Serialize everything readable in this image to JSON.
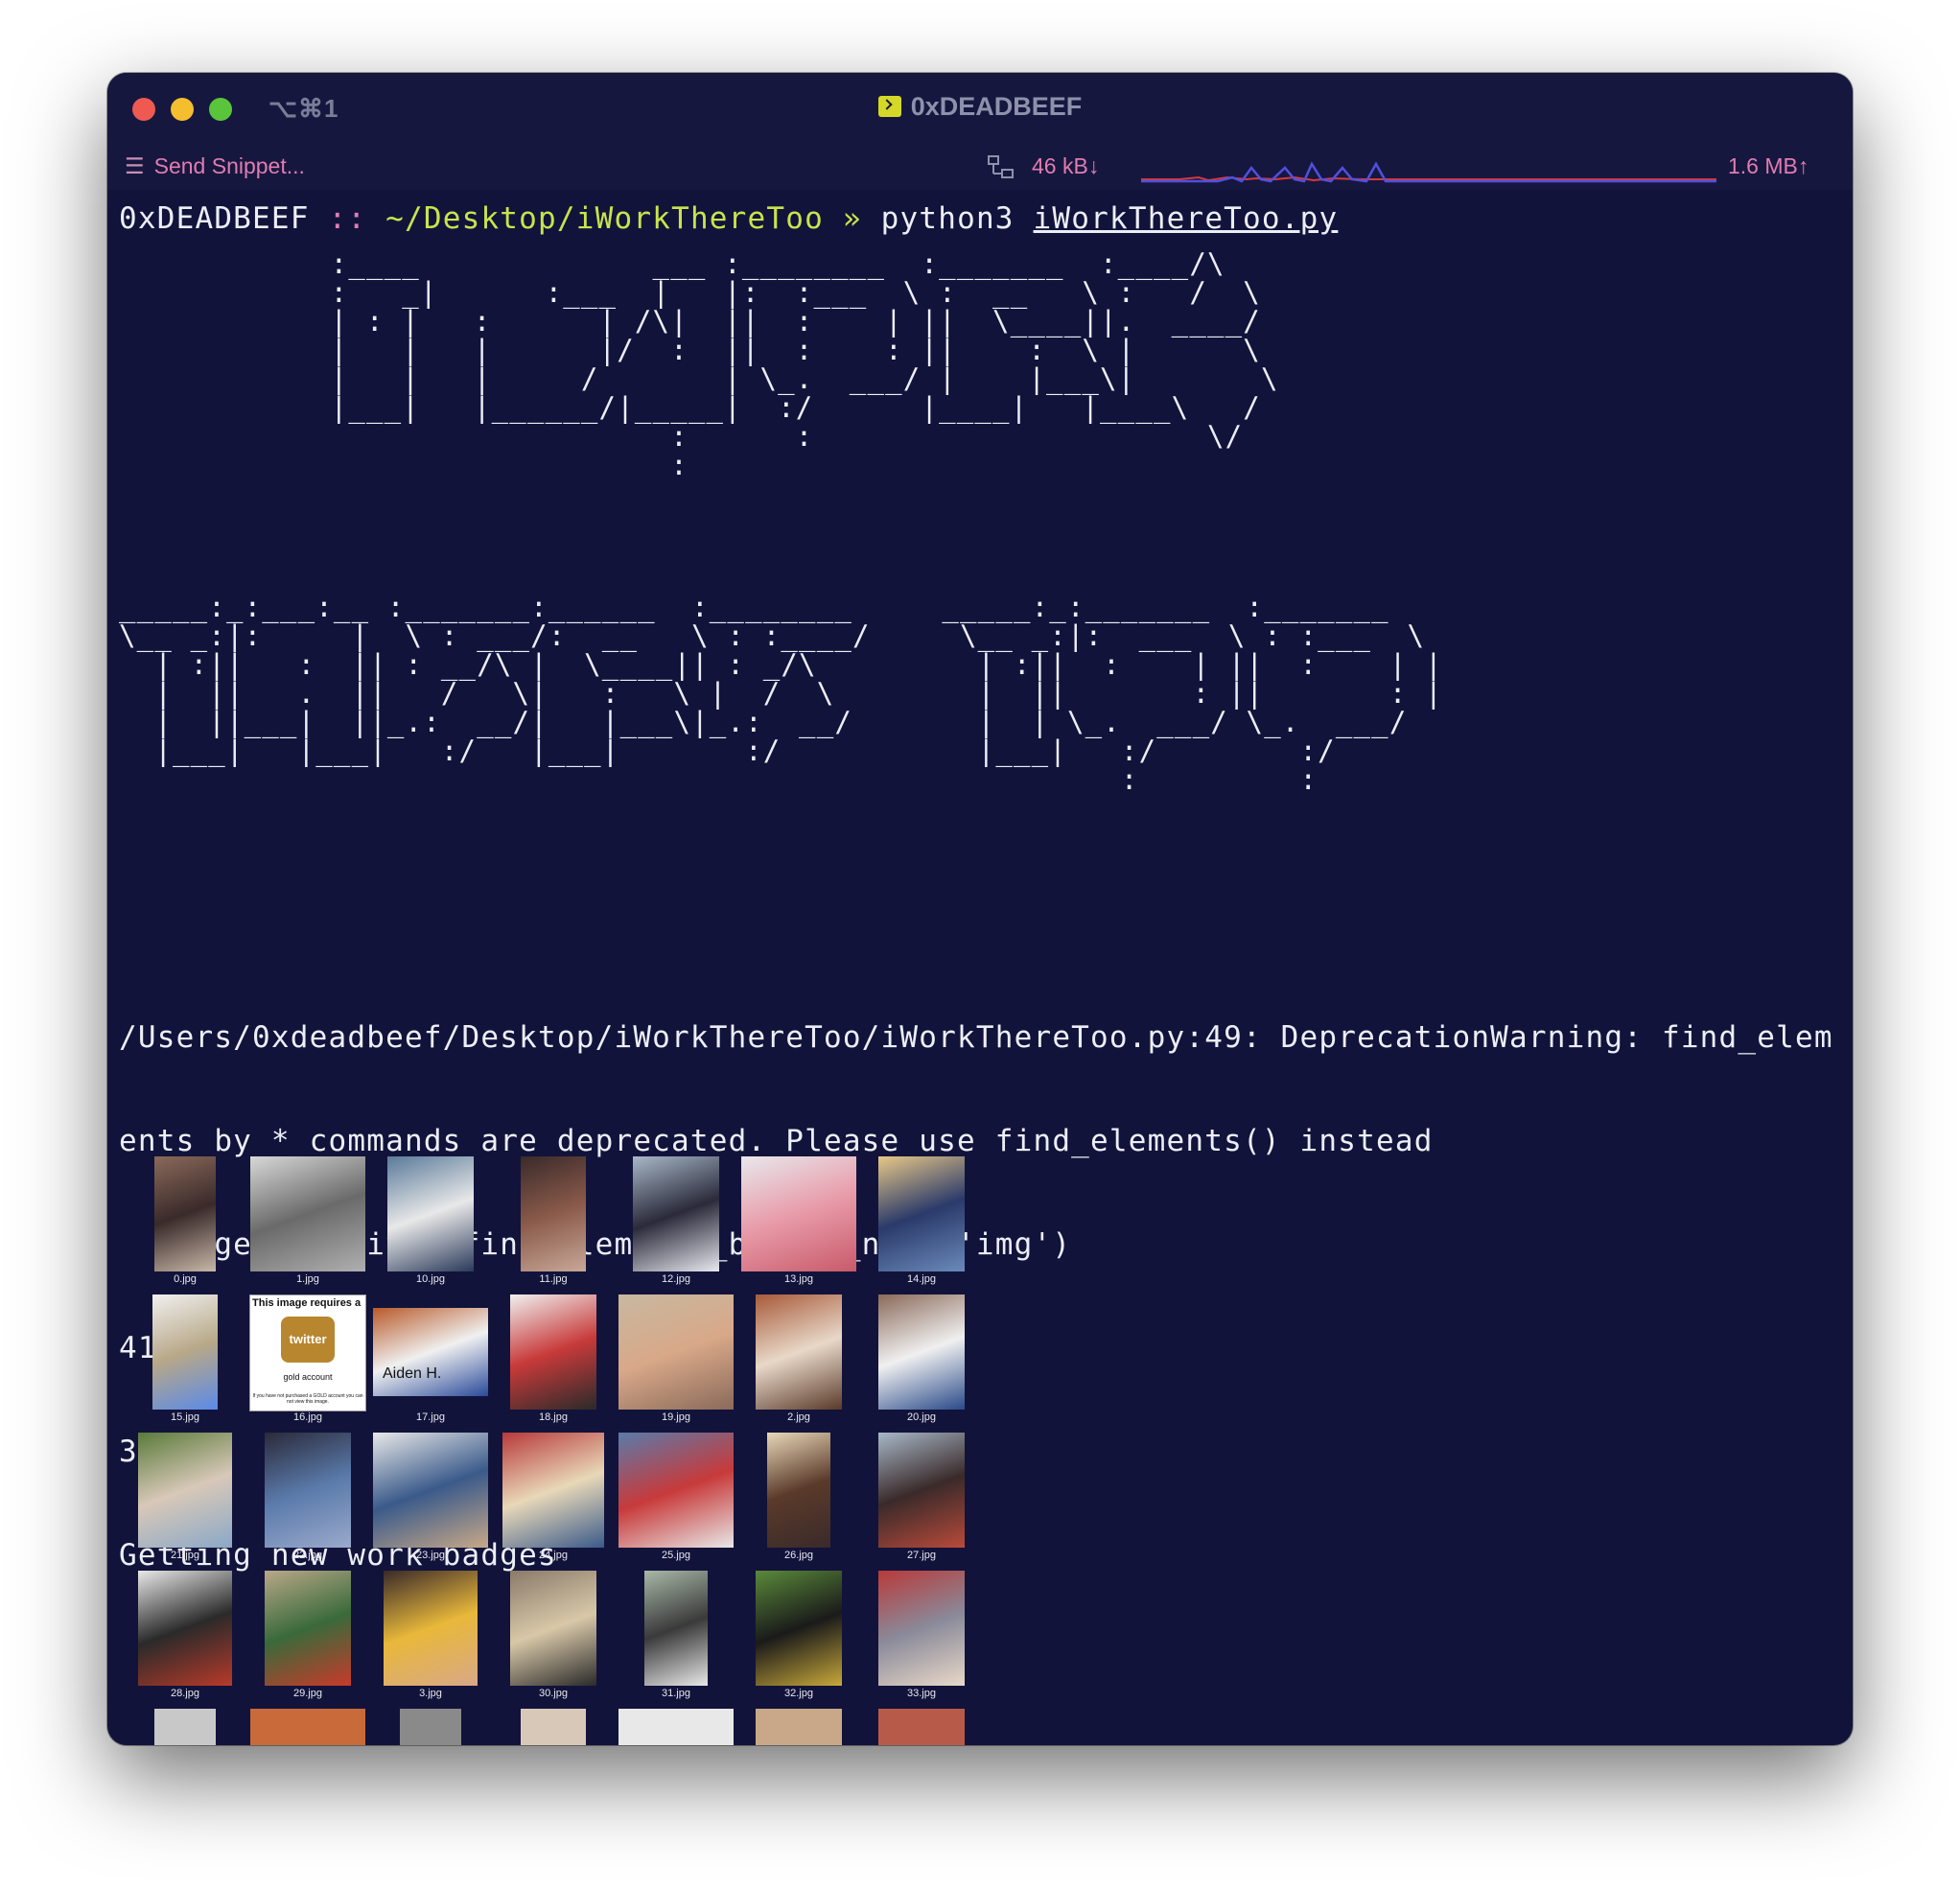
{
  "window": {
    "shortcut": "⌥⌘1",
    "title": "0xDEADBEEF"
  },
  "toolbar": {
    "snippet_icon": "menu-icon",
    "snippet_label": "Send Snippet...",
    "net_download": "46 kB↓",
    "net_upload": "1.6 MB↑"
  },
  "prompt": {
    "host": "0xDEADBEEF",
    "separator": "::",
    "path": "~/Desktop/iWorkThereToo",
    "arrow": "»",
    "command": "python3",
    "file": "iWorkThereToo.py"
  },
  "banner": {
    "line1": "I WORK",
    "line2": "THERE TOO"
  },
  "output": [
    "/Users/0xdeadbeef/Desktop/iWorkThereToo/iWorkThereToo.py:49: DeprecationWarning: find_elem",
    "ents_by_* commands are deprecated. Please use find_elements() instead",
    "  images = driver.find_elements_by_tag_name('img')",
    "41",
    "36",
    "Getting new work badges"
  ],
  "gallery": {
    "images": [
      {
        "file": "0.jpg",
        "colors": [
          "#8a6a5a",
          "#3a2a2a",
          "#c8b8a8"
        ]
      },
      {
        "file": "1.jpg",
        "colors": [
          "#d8d8d8",
          "#6a6a6a",
          "#b0b0b0"
        ]
      },
      {
        "file": "10.jpg",
        "colors": [
          "#5a7a9a",
          "#e8e8e8",
          "#2a3a5a"
        ]
      },
      {
        "file": "11.jpg",
        "colors": [
          "#3a2a2a",
          "#8a5a4a",
          "#c8a898"
        ]
      },
      {
        "file": "12.jpg",
        "colors": [
          "#a8b8c8",
          "#2a2a3a",
          "#e8e8f0"
        ]
      },
      {
        "file": "13.jpg",
        "colors": [
          "#e8e8ec",
          "#e89aa8",
          "#c85a6a"
        ]
      },
      {
        "file": "14.jpg",
        "colors": [
          "#e8c888",
          "#2a3a6a",
          "#6a8aba"
        ]
      },
      {
        "file": "15.jpg",
        "colors": [
          "#f0f0f0",
          "#b8a888",
          "#5a8ae8"
        ]
      },
      {
        "file": "16.jpg",
        "colors": [
          "#ffffff",
          "#b8862e",
          "#111111"
        ]
      },
      {
        "file": "17.jpg",
        "colors": [
          "#b85a2a",
          "#f0f0f0",
          "#2a4a9a"
        ]
      },
      {
        "file": "18.jpg",
        "colors": [
          "#f0f0f0",
          "#c83a3a",
          "#2a2a2a"
        ]
      },
      {
        "file": "19.jpg",
        "colors": [
          "#c8b8a0",
          "#d8a888",
          "#8a6a5a"
        ]
      },
      {
        "file": "2.jpg",
        "colors": [
          "#a85a3a",
          "#e8d8c8",
          "#5a3a2a"
        ]
      },
      {
        "file": "20.jpg",
        "colors": [
          "#8a6a5a",
          "#f0f0f0",
          "#2a4a8a"
        ]
      },
      {
        "file": "21.jpg",
        "colors": [
          "#5a7a3a",
          "#d8c8b8",
          "#8aa8c8"
        ]
      },
      {
        "file": "22.jpg",
        "colors": [
          "#2a2a3a",
          "#5a7aaa",
          "#9aaacc"
        ]
      },
      {
        "file": "23.jpg",
        "colors": [
          "#e8e8e8",
          "#3a5a8a",
          "#c8a888"
        ]
      },
      {
        "file": "24.jpg",
        "colors": [
          "#b83a3a",
          "#e8d8b8",
          "#3a5a8a"
        ]
      },
      {
        "file": "25.jpg",
        "colors": [
          "#5a7aaa",
          "#c83a3a",
          "#e8e8e8"
        ]
      },
      {
        "file": "26.jpg",
        "colors": [
          "#e8d8b8",
          "#5a3a2a",
          "#3a2a2a"
        ]
      },
      {
        "file": "27.jpg",
        "colors": [
          "#a8b8c8",
          "#3a2a2a",
          "#b84a3a"
        ]
      },
      {
        "file": "28.jpg",
        "colors": [
          "#e8e8e8",
          "#2a2a2a",
          "#b83a2a"
        ]
      },
      {
        "file": "29.jpg",
        "colors": [
          "#b8a888",
          "#3a6a3a",
          "#c83a2a"
        ]
      },
      {
        "file": "3.jpg",
        "colors": [
          "#3a2a2a",
          "#e8b83a",
          "#d8a888"
        ]
      },
      {
        "file": "30.jpg",
        "colors": [
          "#8a7a6a",
          "#d8c8a8",
          "#2a2a2a"
        ]
      },
      {
        "file": "31.jpg",
        "colors": [
          "#a8b8a8",
          "#3a3a3a",
          "#e8e8e8"
        ]
      },
      {
        "file": "32.jpg",
        "colors": [
          "#5a8a3a",
          "#1a1a1a",
          "#c8a83a"
        ]
      },
      {
        "file": "33.jpg",
        "colors": [
          "#b83a3a",
          "#8a8a9a",
          "#e8d8c8"
        ]
      }
    ],
    "twitter_card": {
      "header": "This image requires a",
      "logo": "twitter",
      "sub": "gold account",
      "note": "If you have not purchased a GOLD account you can not view this image."
    },
    "badge_card": {
      "name": "Aiden H."
    }
  }
}
